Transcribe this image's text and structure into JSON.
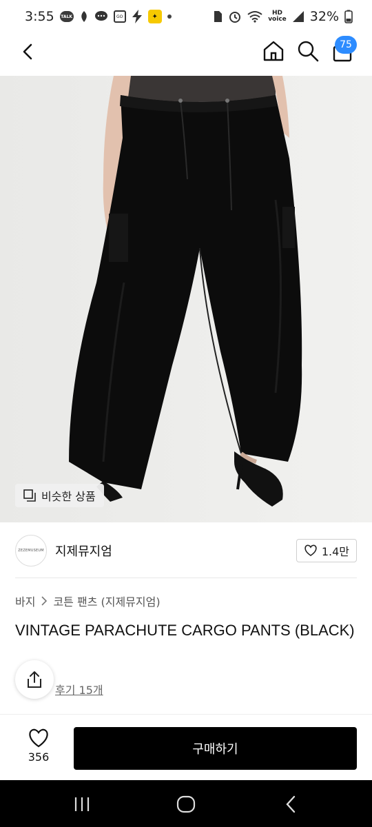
{
  "status_bar": {
    "time": "3:55",
    "battery": "32%",
    "hd_voice": "HD\nvoice",
    "icons": [
      "talk-icon",
      "notification-icon",
      "chat-icon",
      "sd-icon",
      "bolt-icon",
      "yellow-app-icon",
      "dot-icon",
      "sim-icon",
      "alarm-icon",
      "wifi-icon",
      "battery-icon"
    ]
  },
  "nav": {
    "cart_count": "75"
  },
  "product": {
    "similar_label": "비슷한 상품",
    "brand_logo_text": "ZEZEMUSEUM",
    "brand_name": "지제뮤지엄",
    "like_count": "1.4만",
    "breadcrumb": [
      "바지",
      "코튼 팬츠 (지제뮤지엄)"
    ],
    "title": "VINTAGE PARACHUTE CARGO PANTS (BLACK)",
    "review_label": "후기 15개"
  },
  "bottom_bar": {
    "wish_count": "356",
    "buy_label": "구매하기"
  },
  "colors": {
    "accent": "#2d8cff",
    "buy_button": "#000000"
  }
}
